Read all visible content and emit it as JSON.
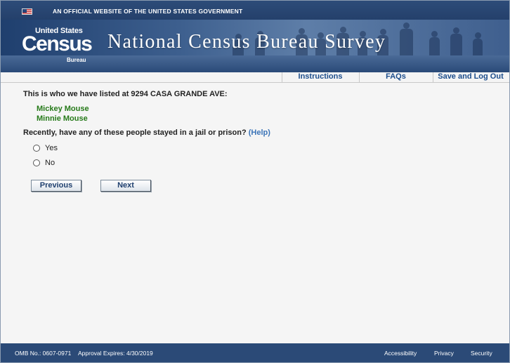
{
  "gov_banner": {
    "text": "AN OFFICIAL WEBSITE OF THE UNITED STATES GOVERNMENT"
  },
  "logo": {
    "top": "United States",
    "main": "Census",
    "sub": "Bureau"
  },
  "site_title": "National Census Bureau Survey",
  "nav": {
    "items": [
      {
        "label": "Instructions"
      },
      {
        "label": "FAQs"
      },
      {
        "label": "Save and Log Out"
      }
    ]
  },
  "content": {
    "intro": "This is who we have listed at 9294 CASA GRANDE AVE:",
    "people": [
      "Mickey Mouse",
      "Minnie Mouse"
    ],
    "question": "Recently, have any of these people stayed in a jail or prison?",
    "help_label": "(Help)",
    "options": [
      {
        "label": "Yes",
        "selected": false
      },
      {
        "label": "No",
        "selected": false
      }
    ],
    "buttons": {
      "previous": "Previous",
      "next": "Next"
    }
  },
  "footer": {
    "omb": "OMB No.: 0607-0971",
    "expires": "Approval Expires: 4/30/2019",
    "links": [
      "Accessibility",
      "Privacy",
      "Security"
    ]
  },
  "colors": {
    "header_blue": "#24406b",
    "link_blue": "#1c4d8c",
    "name_green": "#267a19",
    "help_blue": "#3b74b8"
  }
}
